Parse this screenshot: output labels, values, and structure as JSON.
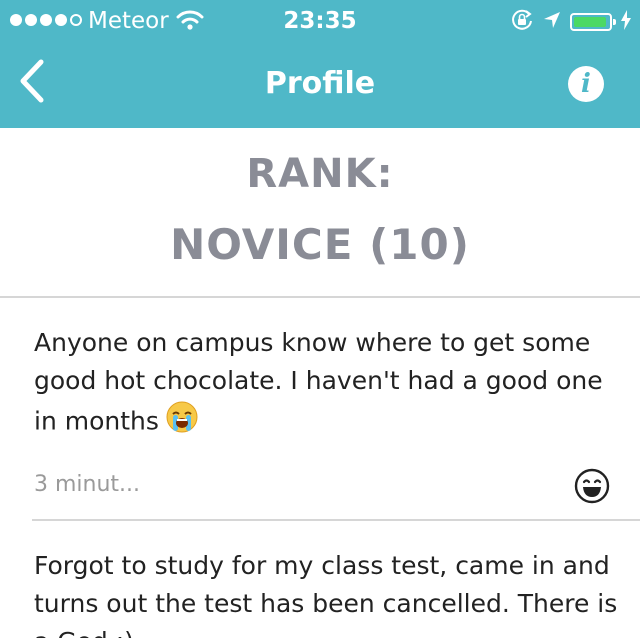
{
  "status_bar": {
    "carrier": "Meteor",
    "time": "23:35",
    "signal_bars_filled": 4,
    "signal_bars_total": 5,
    "battery_level": 0.95,
    "battery_color": "#4cd964"
  },
  "nav": {
    "title": "Profile",
    "back_icon": "chevron-left-icon",
    "info_label": "i",
    "background": "#4fb8c8"
  },
  "rank": {
    "label": "RANK:",
    "value": "NOVICE (10)"
  },
  "posts": [
    {
      "text": "Anyone on campus know where to get some good hot chocolate. I haven't had a good one in months",
      "emoji": "loudly-crying-face-icon",
      "time": "3 minut...",
      "reaction_icon": "smiley-face-icon"
    },
    {
      "text": "Forgot to study for my class test, came in and turns out the test has been cancelled. There is a God :)"
    }
  ]
}
